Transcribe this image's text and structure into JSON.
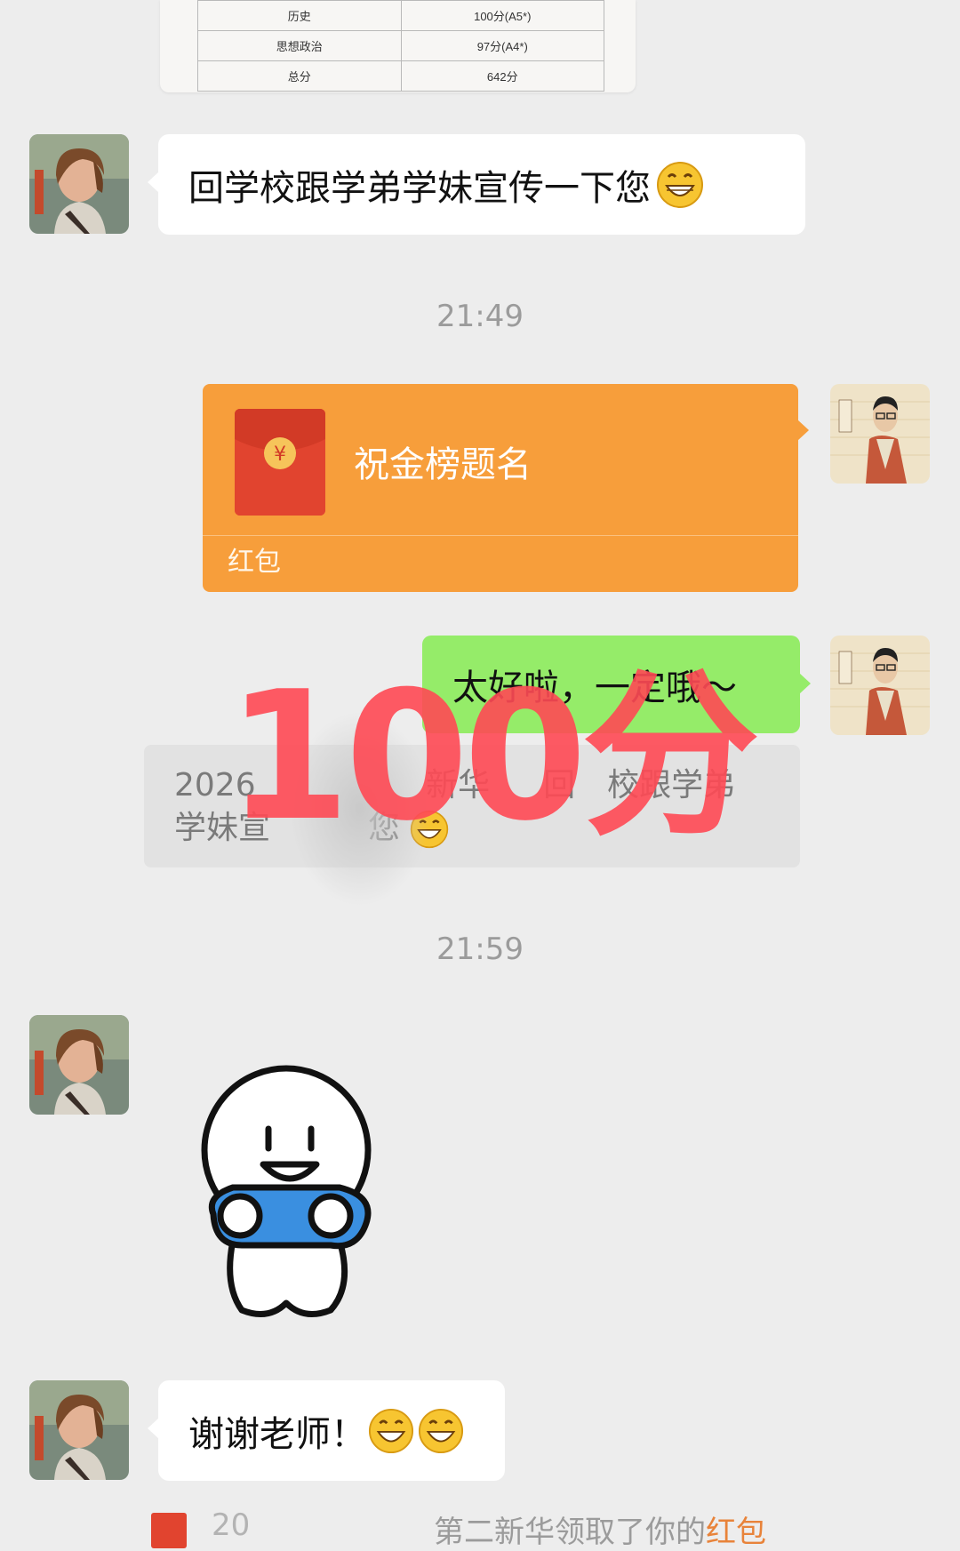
{
  "score_table": {
    "rows": [
      {
        "subject": "历史",
        "score": "100分(A5*)"
      },
      {
        "subject": "思想政治",
        "score": "97分(A4*)"
      },
      {
        "subject": "总分",
        "score": "642分"
      }
    ]
  },
  "messages": {
    "m1": {
      "text": "回学校跟学弟学妹宣传一下您"
    },
    "time1": "21:49",
    "red_packet": {
      "wish": "祝金榜题名",
      "label": "红包",
      "symbol": "¥"
    },
    "reply": {
      "text": "太好啦，一定哦～"
    },
    "quote": {
      "line1": "2026 ",
      "line1_b": "新华",
      "line1_c": "回",
      "line1_d": "校",
      "line1_e": "跟学弟",
      "line2": "学妹宣",
      "line2_b": "您"
    },
    "time2": "21:59",
    "thanks": {
      "text": "谢谢老师！"
    },
    "system": {
      "num": "20",
      "text": "第二新华领取了你的",
      "red": "红包"
    }
  },
  "watermark": "100分",
  "colors": {
    "background": "#ededed",
    "green_bubble": "#95ec69",
    "red_packet": "#f79e3b",
    "watermark": "#ff4a55"
  },
  "icons": {
    "emoji": "grinning-emoji-icon",
    "sticker": "smiling-character-sticker",
    "red_packet": "red-envelope-icon"
  }
}
